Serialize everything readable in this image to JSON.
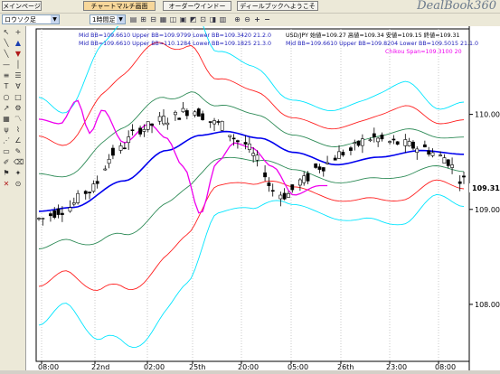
{
  "tabs": [
    {
      "label": "メインページ",
      "active": false
    },
    {
      "label": "チャートマルチ画面",
      "active": true
    },
    {
      "label": "オーダーウインドー",
      "active": false
    },
    {
      "label": "ディールブックへようこそ",
      "active": false
    }
  ],
  "logo": "DealBook360",
  "toolbar": {
    "chart_type_select": "ロウソク足",
    "timeframe_select": "1時間足",
    "icons": [
      "zoom-in-icon",
      "zoom-out-icon",
      "plus-icon",
      "minus-icon"
    ]
  },
  "left_tools": [
    "cursor-icon",
    "crosshair-icon",
    "line-icon",
    "up-arrow-icon",
    "line-icon",
    "down-arrow-icon",
    "hline-icon",
    "channel-icon",
    "fibonacci-icon",
    "text-icon",
    "zoom-icon",
    "ellipse-icon",
    "rect-icon",
    "arrow-icon",
    "grid-icon",
    "delete-icon"
  ],
  "legend": {
    "line1": "Mid BB=109.6610 Upper BB=109.9799 Lower BB=109.3420  21.2.0",
    "line2": "Mid BB=109.6610 Upper BB=110.1284 Lower BB=109.1825  21.3.0",
    "line3": "USD/JPY 始値=109.27 高値=109.34 安値=109.15 終値=109.31",
    "line4": "Mid BB=109.6610 Upper BB=109.8204 Lower BB=109.5015  21.1.0",
    "line5": "Chikou Span=109.3100  20"
  },
  "colors": {
    "bb3": "#00e5ff",
    "bb2": "#ff2020",
    "bb1": "#2e8b57",
    "mid": "#0000ee",
    "chikou": "#ee00ee",
    "candle": "#000000"
  },
  "chart_data": {
    "type": "candlestick",
    "symbol": "USD/JPY",
    "yticks": [
      "110.00",
      "109.00",
      "108.00"
    ],
    "current_price": "109.31",
    "xticks": [
      "08:00",
      "22nd",
      "02:00",
      "25th",
      "20:00",
      "05:00",
      "26th",
      "23:00",
      "08:00"
    ],
    "ylim": [
      107.4,
      110.9
    ]
  }
}
